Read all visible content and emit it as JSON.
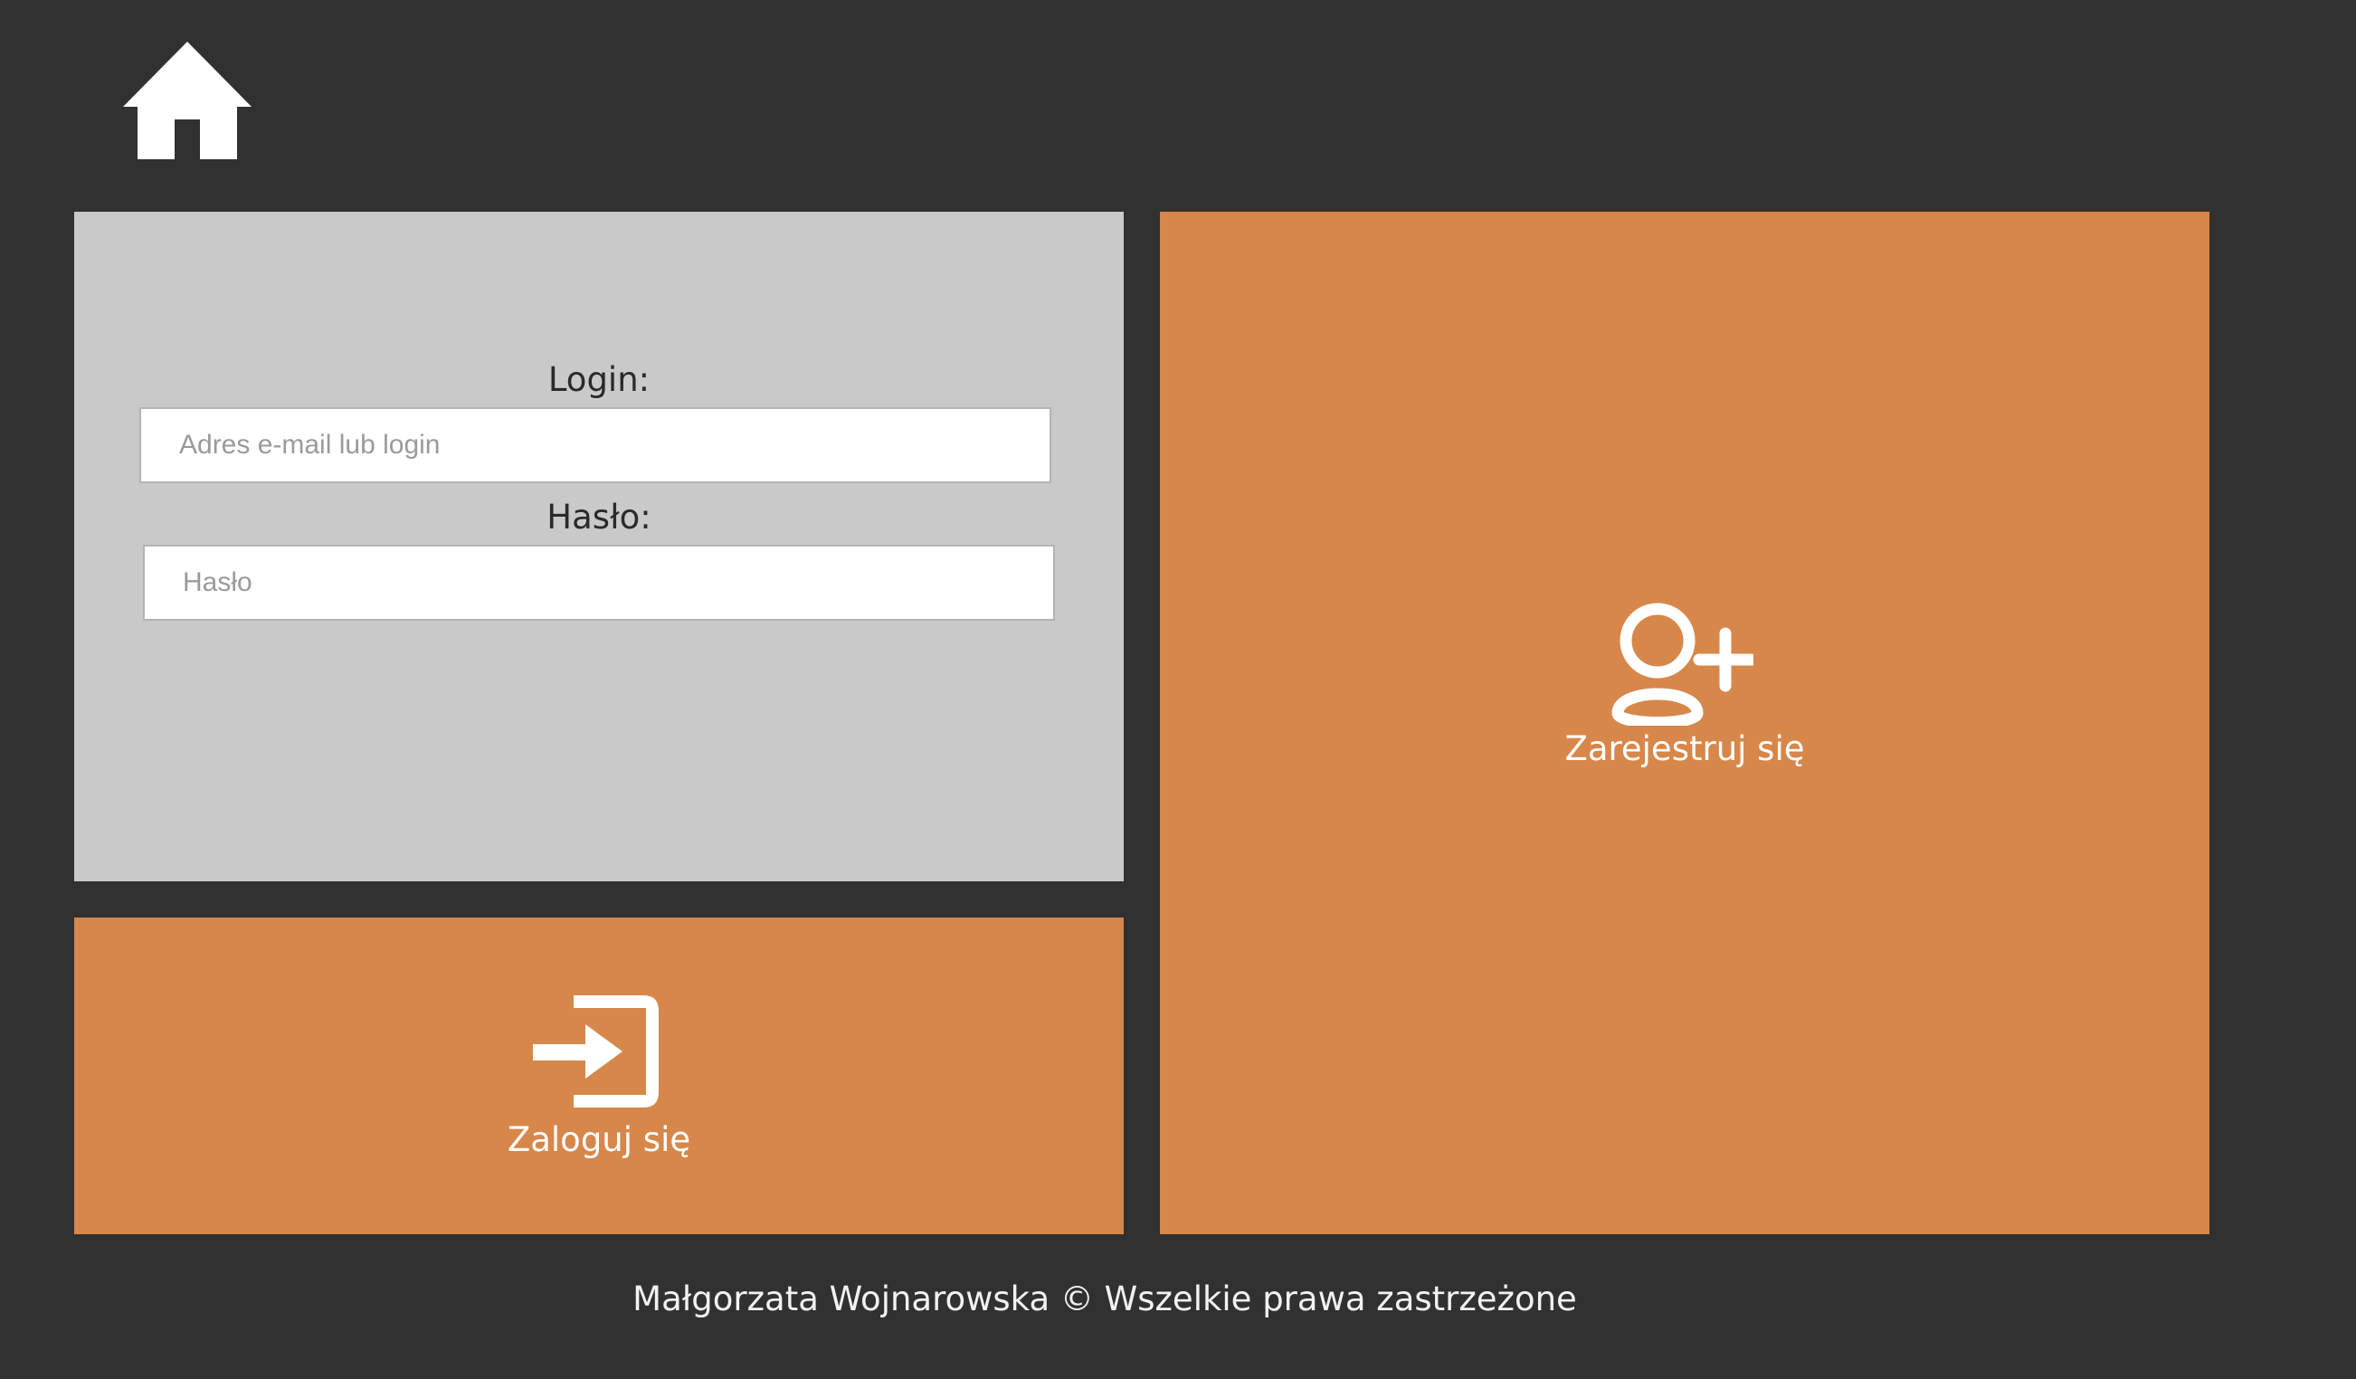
{
  "header": {
    "home_icon": "home-icon"
  },
  "login_form": {
    "login_label": "Login:",
    "login_placeholder": "Adres e-mail lub login",
    "password_label": "Hasło:",
    "password_placeholder": "Hasło"
  },
  "login_tile": {
    "icon": "sign-in-icon",
    "label": "Zaloguj się"
  },
  "register_tile": {
    "icon": "user-plus-icon",
    "label": "Zarejestruj się"
  },
  "footer": {
    "text": "Małgorzata Wojnarowska © Wszelkie prawa zastrzeżone"
  },
  "colors": {
    "background": "#313131",
    "panel": "#c9c9c9",
    "accent": "#d7874a",
    "text_light": "#ffffff"
  }
}
